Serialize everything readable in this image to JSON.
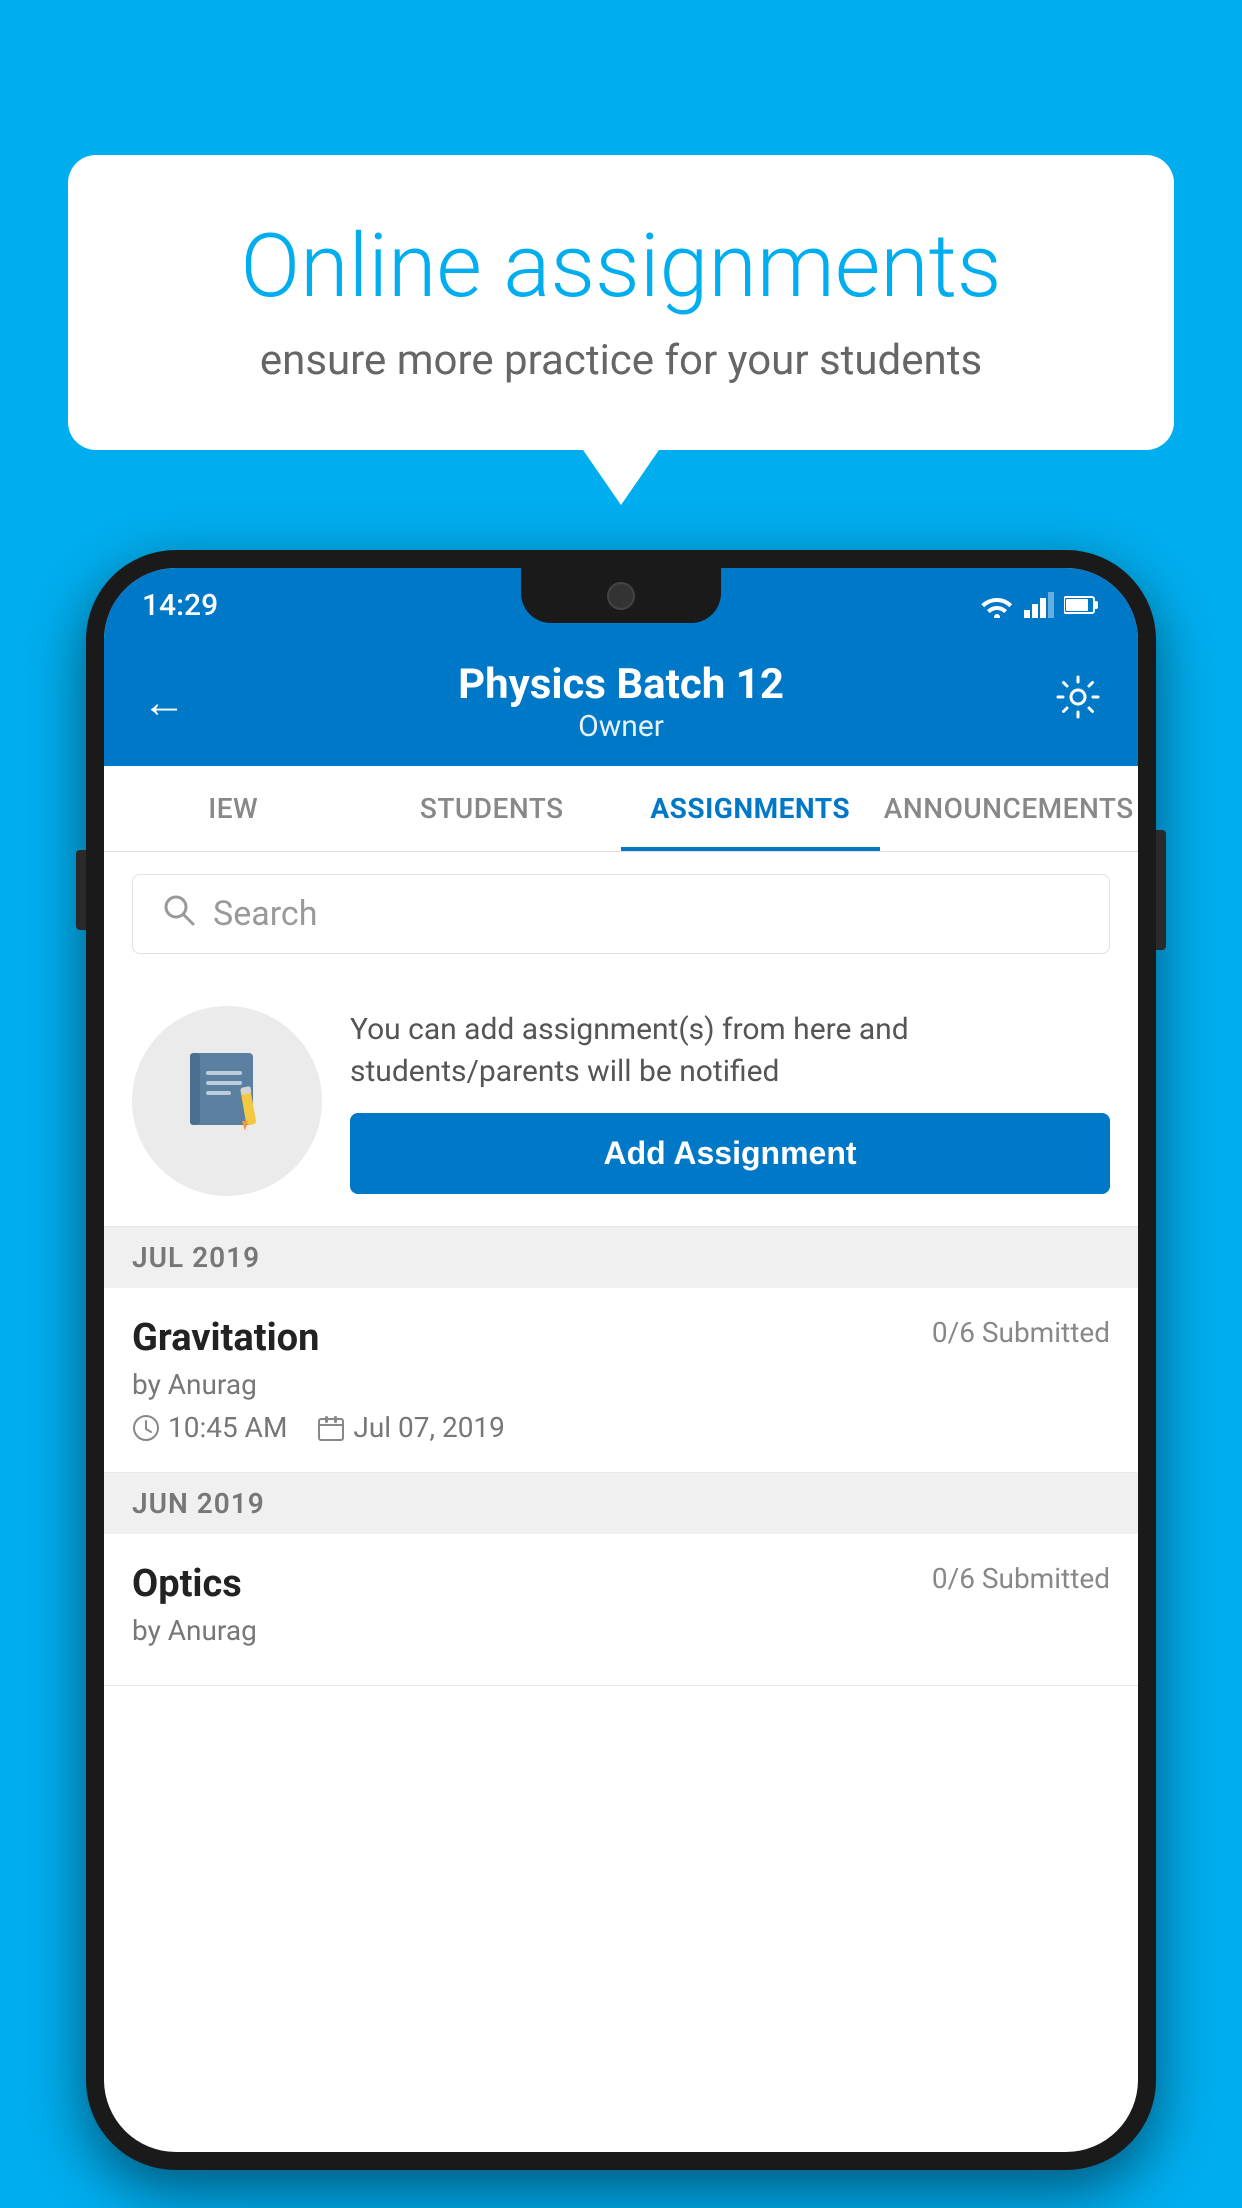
{
  "background_color": "#00AEEF",
  "speech_bubble": {
    "title": "Online assignments",
    "subtitle": "ensure more practice for your students"
  },
  "phone": {
    "status_bar": {
      "time": "14:29"
    },
    "header": {
      "title": "Physics Batch 12",
      "subtitle": "Owner",
      "back_label": "←",
      "settings_label": "⚙"
    },
    "tabs": [
      {
        "id": "iew",
        "label": "IEW",
        "active": false
      },
      {
        "id": "students",
        "label": "STUDENTS",
        "active": false
      },
      {
        "id": "assignments",
        "label": "ASSIGNMENTS",
        "active": true
      },
      {
        "id": "announcements",
        "label": "ANNOUNCEMENTS",
        "active": false
      }
    ],
    "search": {
      "placeholder": "Search"
    },
    "add_assignment": {
      "description": "You can add assignment(s) from here and students/parents will be notified",
      "button_label": "Add Assignment"
    },
    "sections": [
      {
        "id": "jul-2019",
        "header": "JUL 2019",
        "assignments": [
          {
            "id": "gravitation",
            "name": "Gravitation",
            "submitted": "0/6 Submitted",
            "by": "by Anurag",
            "time": "10:45 AM",
            "date": "Jul 07, 2019"
          }
        ]
      },
      {
        "id": "jun-2019",
        "header": "JUN 2019",
        "assignments": [
          {
            "id": "optics",
            "name": "Optics",
            "submitted": "0/6 Submitted",
            "by": "by Anurag",
            "time": "",
            "date": ""
          }
        ]
      }
    ]
  }
}
